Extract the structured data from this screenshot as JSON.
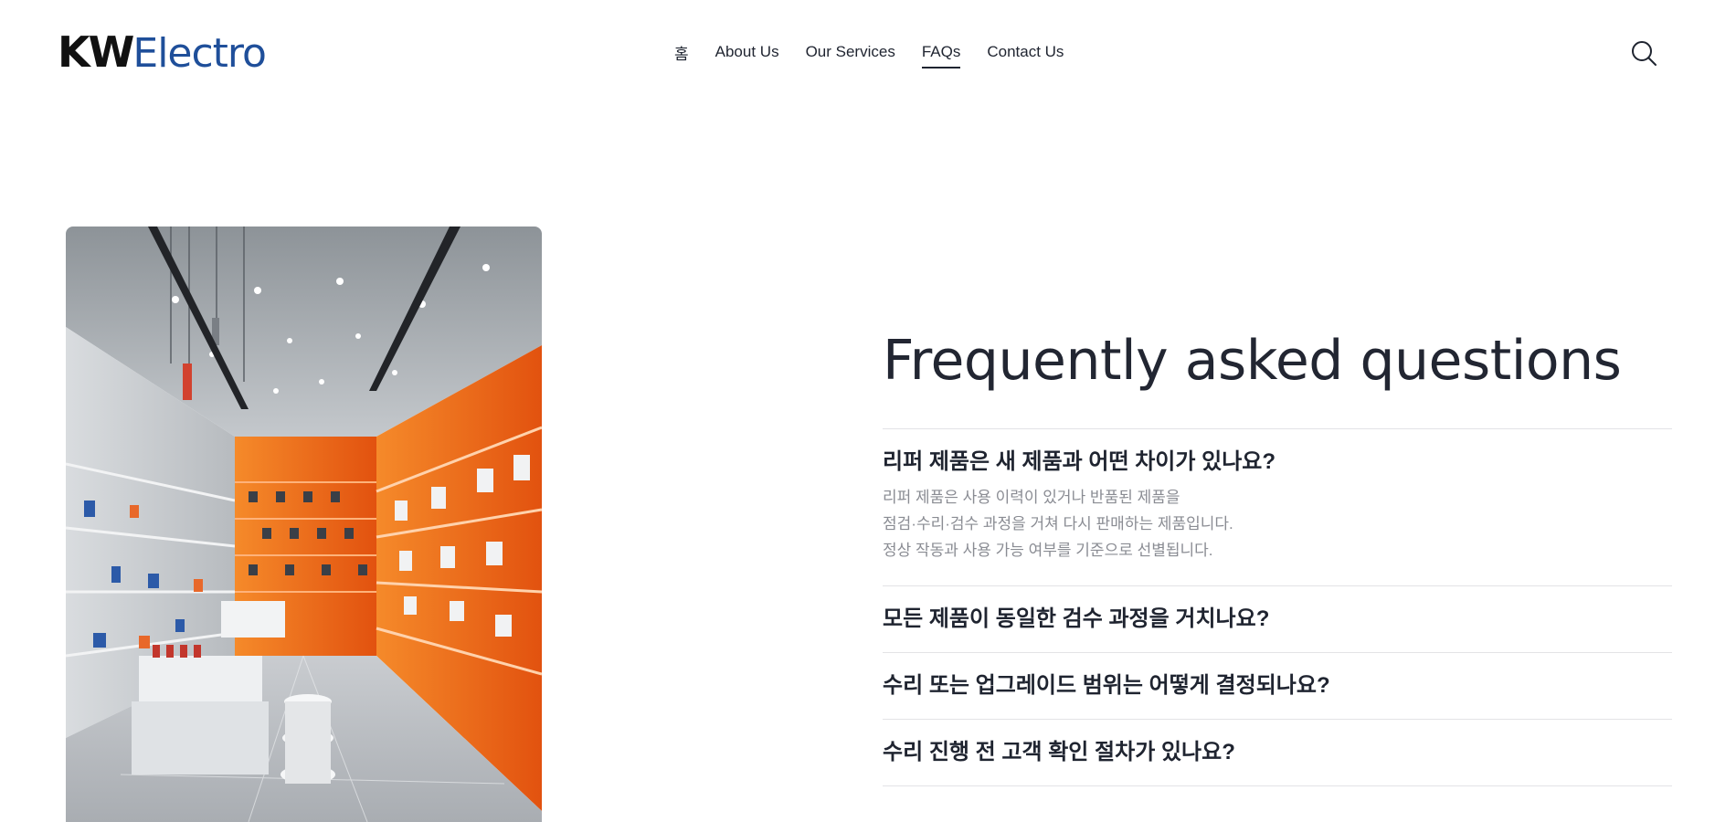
{
  "header": {
    "logo": {
      "part1": "KW",
      "part2": "Electro"
    },
    "nav": [
      {
        "label": "홈"
      },
      {
        "label": "About Us"
      },
      {
        "label": "Our Services"
      },
      {
        "label": "FAQs",
        "active": true
      },
      {
        "label": "Contact Us"
      }
    ],
    "search_icon": "search-icon"
  },
  "hero_image": {
    "subject": "electronics-store-interior"
  },
  "faq": {
    "title": "Frequently asked questions",
    "items": [
      {
        "question": "리퍼 제품은 새 제품과 어떤 차이가 있나요?",
        "expanded": true,
        "answer_lines": [
          "리퍼 제품은 사용 이력이 있거나 반품된 제품을",
          "점검·수리·검수 과정을 거쳐 다시 판매하는 제품입니다.",
          "정상 작동과 사용 가능 여부를 기준으로 선별됩니다."
        ]
      },
      {
        "question": "모든 제품이 동일한 검수 과정을 거치나요?",
        "expanded": false
      },
      {
        "question": "수리 또는 업그레이드 범위는 어떻게 결정되나요?",
        "expanded": false
      },
      {
        "question": "수리 진행 전 고객 확인 절차가 있나요?",
        "expanded": false
      }
    ]
  },
  "colors": {
    "logo_dark": "#111111",
    "logo_blue": "#1f4f9a",
    "text": "#1f2430",
    "muted": "#8a8c93",
    "divider": "#e3e3e6",
    "shelf_orange": "#f06a1c"
  }
}
